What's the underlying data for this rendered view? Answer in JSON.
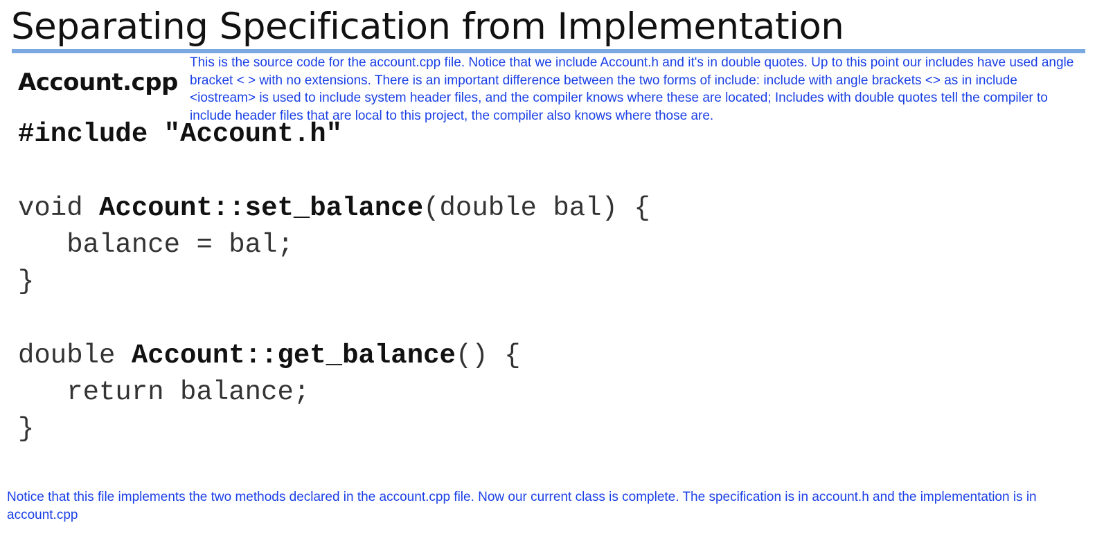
{
  "slide": {
    "title": "Separating Specification from Implementation",
    "file_label": "Account.cpp"
  },
  "notes": {
    "top": "This is the source code for the account.cpp file. Notice that we include Account.h and it's in double quotes. Up to this point our includes have used angle bracket < > with no extensions. There is an important difference between the two forms of include: include with angle brackets <> as in include <iostream> is used to include system header files, and the compiler knows where these are located; Includes with double quotes tell the compiler to include header files that are local to this project, the compiler also knows where those are.",
    "bottom": "Notice that this file implements the two methods declared in the account.cpp file. Now our current class is complete. The specification is in account.h and the implementation is in account.cpp"
  },
  "code": {
    "include": "#include \"Account.h\"",
    "set_balance": {
      "return_type": "void ",
      "name": "Account::set_balance",
      "params": "(double bal) {",
      "body": "   balance = bal;",
      "close": "}"
    },
    "get_balance": {
      "return_type": "double ",
      "name": "Account::get_balance",
      "params": "() {",
      "body": "   return balance;",
      "close": "}"
    }
  }
}
